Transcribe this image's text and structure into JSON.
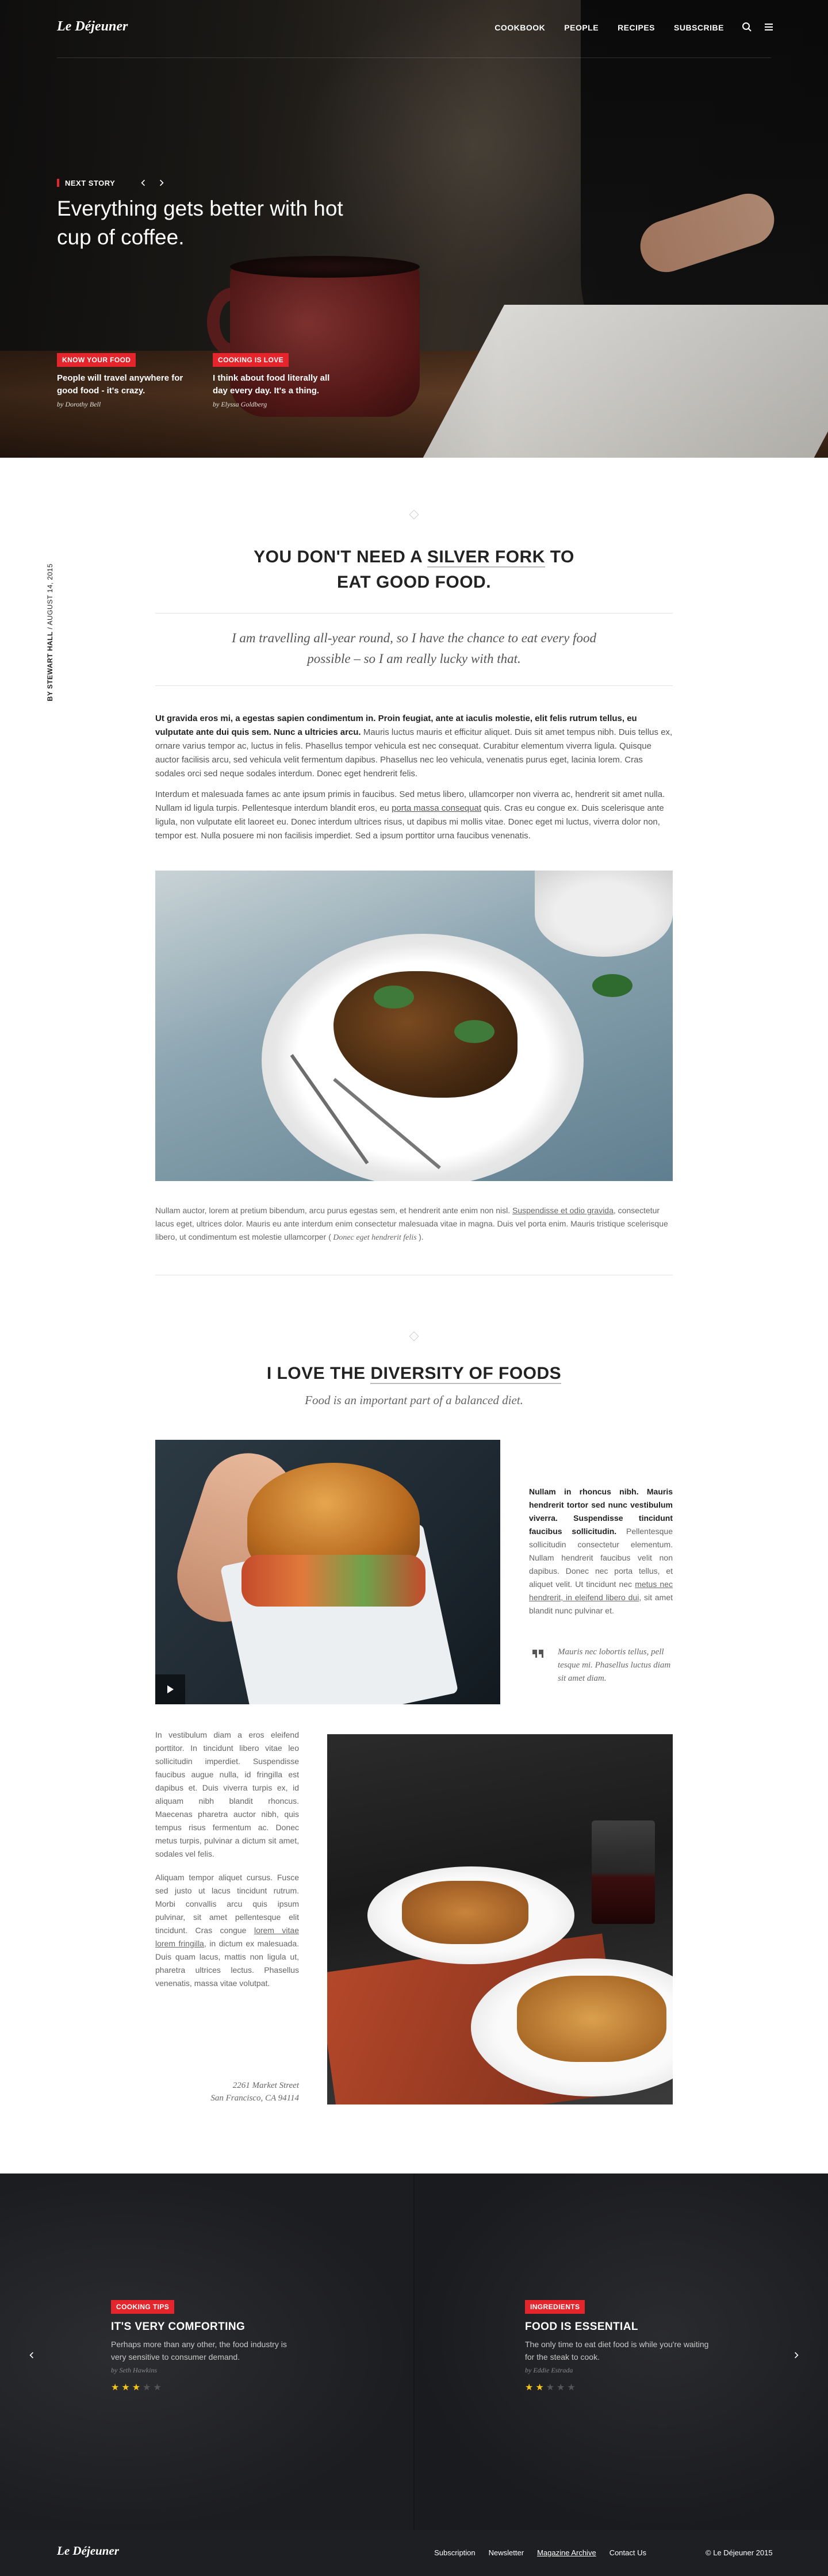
{
  "brand": {
    "logo": "Le Déjeuner"
  },
  "nav": {
    "items": [
      "COOKBOOK",
      "PEOPLE",
      "RECIPES",
      "SUBSCRIBE"
    ],
    "search_icon": "search-icon",
    "menu_icon": "menu-icon"
  },
  "hero": {
    "next_label": "NEXT STORY",
    "title": "Everything gets better with hot cup of coffee.",
    "cards": [
      {
        "tag": "KNOW YOUR FOOD",
        "title": "People will travel anywhere for good food - it's crazy.",
        "byline": "by Dorothy Bell"
      },
      {
        "tag": "COOKING IS LOVE",
        "title": "I think about food literally all day every day. It's a thing.",
        "byline": "by Elyssa Goldberg"
      }
    ]
  },
  "article": {
    "byline_author": "BY STEWART HALL",
    "byline_date": "AUGUST 14, 2015",
    "heading_pre": "YOU DON'T NEED A ",
    "heading_underlined": "SILVER FORK",
    "heading_mid": " TO",
    "heading_line2_pre": "EAT ",
    "heading_bold": "GOOD FOOD.",
    "pullquote": "I am travelling all-year round, so I have the chance to eat every food possible – so I am really lucky with that.",
    "p1_bold": "Ut gravida eros mi, a egestas sapien condimentum in. Proin feugiat, ante at iaculis molestie, elit felis rutrum tellus, eu vulputate ante dui quis sem. Nunc a ultricies arcu.",
    "p1_rest": " Mauris luctus mauris et efficitur aliquet. Duis sit amet tempus nibh. Duis tellus ex, ornare varius tempor ac, luctus in felis. Phasellus tempor vehicula est nec consequat. Curabitur elementum viverra ligula. Quisque auctor facilisis arcu, sed vehicula velit fermentum dapibus. Phasellus nec leo vehicula, venenatis purus eget, lacinia lorem. Cras sodales orci sed neque sodales interdum. Donec eget hendrerit felis.",
    "p2_a": "Interdum et malesuada fames ac ante ipsum primis in faucibus. Sed metus libero, ullamcorper non viverra ac, hendrerit sit amet nulla. Nullam id ligula turpis. Pellentesque interdum blandit eros, eu ",
    "p2_link": "porta massa consequat",
    "p2_b": " quis. Cras eu congue ex. Duis scelerisque ante ligula, non vulputate elit laoreet eu. Donec interdum ultrices risus, ut dapibus mi mollis vitae. Donec eget mi luctus, viverra dolor non, tempor est. Nulla posuere mi non facilisis imperdiet. Sed a ipsum porttitor urna faucibus venenatis.",
    "caption_a": "Nullam auctor, lorem at pretium bibendum, arcu purus egestas sem, et hendrerit ante enim non nisl. ",
    "caption_link": "Suspendisse et odio gravida",
    "caption_b": ", consectetur lacus eget, ultrices dolor. Mauris eu ante interdum enim consectetur malesuada vitae in magna. Duis vel porta enim. Mauris tristique scelerisque libero, ut condimentum est molestie ullamcorper (",
    "caption_italic": " Donec eget hendrerit felis ",
    "caption_end": ")."
  },
  "diversity": {
    "heading_pre": "I LOVE THE ",
    "heading_underlined": "DIVERSITY OF FOODS",
    "subtitle": "Food is an important part of a balanced diet.",
    "side_bold": "Nullam in rhoncus nibh. Mauris hendrerit tortor sed nunc vestibulum viverra. Suspendisse tincidunt faucibus sollicitudin.",
    "side_a": " Pellentesque sollicitudin consectetur elementum. Nullam hendrerit faucibus velit non dapibus. Donec nec porta tellus, et aliquet velit. Ut tincidunt nec ",
    "side_link": "metus nec hendrerit, in eleifend libero dui",
    "side_b": ", sit amet blandit nunc pulvinar et.",
    "side_quote": "Mauris nec lobortis tellus, pell tesque mi. Phasellus luctus diam sit amet diam.",
    "left_p1": "In vestibulum diam a eros eleifend porttitor. In tincidunt libero vitae leo sollicitudin imperdiet. Suspendisse faucibus augue nulla, id fringilla est dapibus et. Duis viverra turpis ex, id aliquam nibh blandit rhoncus. Maecenas pharetra auctor nibh, quis tempus risus fermentum ac. Donec metus turpis, pulvinar a dictum sit amet, sodales vel felis.",
    "left_p2_a": "Aliquam tempor aliquet cursus. Fusce sed justo ut lacus tincidunt rutrum. Morbi convallis arcu quis ipsum pulvinar, sit amet pellentesque elit tincidunt. Cras congue ",
    "left_p2_link": "lorem vitae lorem fringilla",
    "left_p2_b": ", in dictum ex malesuada. Duis quam lacus, mattis non ligula ut, pharetra ultrices lectus. Phasellus venenatis, massa vitae volutpat.",
    "address_1": "2261 Market Street",
    "address_2": "San Francisco, CA 94114"
  },
  "carousel": {
    "slides": [
      {
        "tag": "COOKING TIPS",
        "title": "IT'S VERY COMFORTING",
        "desc": "Perhaps more than any other, the food industry is very sensitive to consumer demand.",
        "byline": "by Seth Hawkins",
        "rating": 3,
        "max_rating": 5
      },
      {
        "tag": "INGREDIENTS",
        "title": "FOOD IS ESSENTIAL",
        "desc": "The only time to eat diet food is while you're waiting for the steak to cook.",
        "byline": "by Eddie Estrada",
        "rating": 2,
        "max_rating": 5
      }
    ]
  },
  "footer": {
    "logo": "Le Déjeuner",
    "links": [
      "Subscription",
      "Newsletter",
      "Magazine Archive",
      "Contact Us"
    ],
    "copyright": "© Le Déjeuner 2015"
  },
  "colors": {
    "accent": "#e4262c",
    "dark": "#1e1f22",
    "star": "#f5c518"
  }
}
